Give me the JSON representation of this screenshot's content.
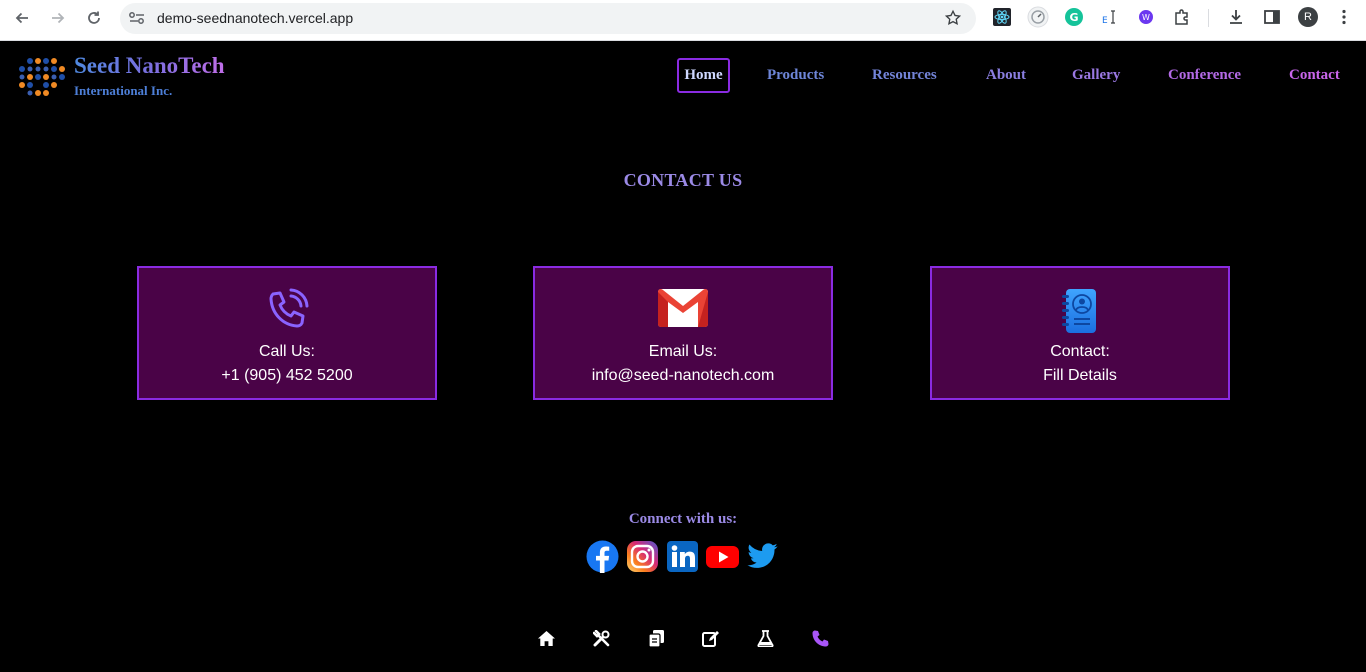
{
  "browser": {
    "url": "demo-seednanotech.vercel.app",
    "profile_initial": "R",
    "extensions": [
      "react-devtools-icon",
      "lighthouse-icon",
      "grammarly-icon",
      "text-cursor-icon",
      "wappalyzer-icon",
      "puzzle-icon"
    ]
  },
  "brand": {
    "name": "Seed NanoTech",
    "subtitle": "International Inc."
  },
  "nav": {
    "home": "Home",
    "products": "Products",
    "resources": "Resources",
    "about": "About",
    "gallery": "Gallery",
    "conference": "Conference",
    "contact": "Contact"
  },
  "section": {
    "title": "CONTACT US"
  },
  "cards": {
    "call": {
      "label": "Call Us:",
      "value": "+1 (905) 452 5200"
    },
    "email": {
      "label": "Email Us:",
      "value": "info@seed-nanotech.com"
    },
    "contact": {
      "label": "Contact:",
      "value": "Fill Details"
    }
  },
  "social": {
    "heading": "Connect with us:",
    "networks": [
      "facebook-icon",
      "instagram-icon",
      "linkedin-icon",
      "youtube-icon",
      "twitter-icon"
    ]
  },
  "bottom_nav": {
    "items": [
      "home-icon",
      "tools-icon",
      "documents-icon",
      "edit-icon",
      "flask-icon",
      "phone-icon"
    ],
    "active": "phone-icon"
  },
  "colors": {
    "background": "#000000",
    "card_bg": "#4a0347",
    "card_border": "#8a2be2",
    "accent_text": "#9b8ae6",
    "active_nav": "#a855f7"
  }
}
